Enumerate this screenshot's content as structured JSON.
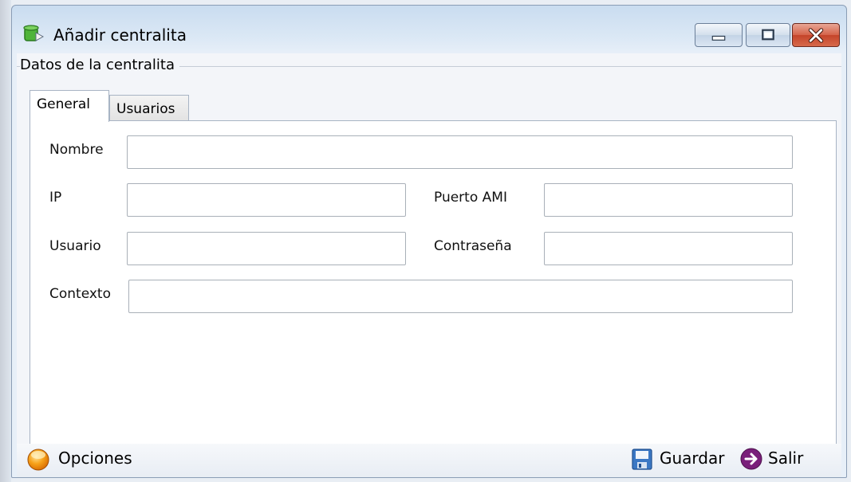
{
  "window": {
    "title": "Añadir centralita",
    "minimize_icon": "minimize-icon",
    "maximize_icon": "maximize-icon",
    "close_icon": "close-icon"
  },
  "group": {
    "legend": "Datos de la centralita"
  },
  "tabs": [
    {
      "label": "General",
      "active": true
    },
    {
      "label": "Usuarios",
      "active": false
    }
  ],
  "form": {
    "nombre": {
      "label": "Nombre",
      "value": ""
    },
    "ip": {
      "label": "IP",
      "value": ""
    },
    "puerto_ami": {
      "label": "Puerto AMI",
      "value": ""
    },
    "usuario": {
      "label": "Usuario",
      "value": ""
    },
    "contrasena": {
      "label": "Contraseña",
      "value": ""
    },
    "contexto": {
      "label": "Contexto",
      "value": ""
    }
  },
  "bottombar": {
    "opciones_label": "Opciones",
    "guardar_label": "Guardar",
    "salir_label": "Salir"
  },
  "colors": {
    "close_button": "#c4442a",
    "opciones_icon": "#f08a00",
    "guardar_icon": "#3b78c4",
    "salir_icon": "#7a1f7a"
  }
}
